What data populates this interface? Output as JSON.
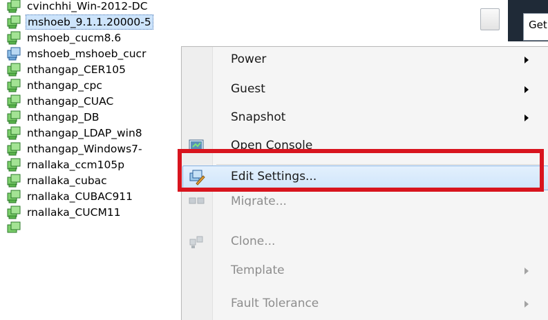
{
  "vm_list": {
    "items": [
      {
        "label": "cvinchhi_Win-2012-DC",
        "selected": false
      },
      {
        "label": "mshoeb_9.1.1.20000-5",
        "selected": true
      },
      {
        "label": "mshoeb_cucm8.6",
        "selected": false
      },
      {
        "label": "mshoeb_mshoeb_cucr",
        "selected": false
      },
      {
        "label": "nthangap_CER105",
        "selected": false
      },
      {
        "label": "nthangap_cpc",
        "selected": false
      },
      {
        "label": "nthangap_CUAC",
        "selected": false
      },
      {
        "label": "nthangap_DB",
        "selected": false
      },
      {
        "label": "nthangap_LDAP_win8",
        "selected": false
      },
      {
        "label": "nthangap_Windows7-",
        "selected": false
      },
      {
        "label": "rnallaka_ccm105p",
        "selected": false
      },
      {
        "label": "rnallaka_cubac",
        "selected": false
      },
      {
        "label": "rnallaka_CUBAC911",
        "selected": false
      },
      {
        "label": "rnallaka_CUCM11",
        "selected": false
      }
    ],
    "icon_name": "virtual-machine-icon"
  },
  "right_panel": {
    "tab_label": "Get"
  },
  "context_menu": {
    "items": [
      {
        "label": "Power",
        "submenu": true,
        "disabled": false,
        "icon": null
      },
      {
        "label": "Guest",
        "submenu": true,
        "disabled": false,
        "icon": null
      },
      {
        "label": "Snapshot",
        "submenu": true,
        "disabled": false,
        "icon": null
      },
      {
        "label": "Open Console",
        "submenu": false,
        "disabled": false,
        "icon": "console-icon"
      },
      {
        "label": "Edit Settings...",
        "submenu": false,
        "disabled": false,
        "icon": "edit-settings-icon",
        "highlighted": true
      },
      {
        "label": "Migrate...",
        "submenu": false,
        "disabled": true,
        "icon": "migrate-icon"
      },
      {
        "label": "Clone...",
        "submenu": false,
        "disabled": true,
        "icon": "clone-icon"
      },
      {
        "label": "Template",
        "submenu": true,
        "disabled": true,
        "icon": null
      },
      {
        "label": "Fault Tolerance",
        "submenu": true,
        "disabled": true,
        "icon": null
      }
    ]
  },
  "colors": {
    "annotation": "#d8141e",
    "selection": "#cde4fb",
    "hover": "#cfe5fb"
  }
}
